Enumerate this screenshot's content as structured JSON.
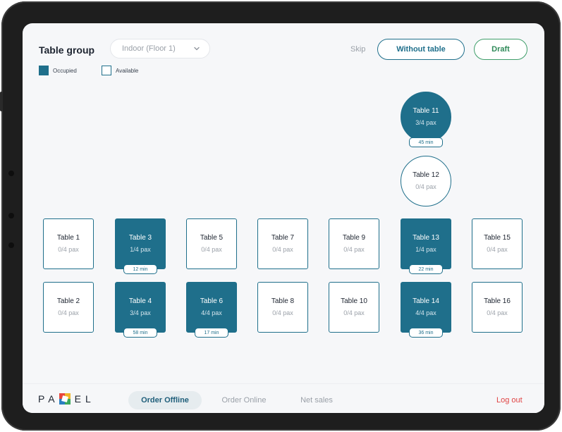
{
  "header": {
    "title": "Table group",
    "dropdown_value": "Indoor (Floor 1)",
    "skip_label": "Skip",
    "without_table_label": "Without table",
    "draft_label": "Draft"
  },
  "legend": {
    "occupied_label": "Occupied",
    "available_label": "Available"
  },
  "colors": {
    "occupied": "#1f6f8b",
    "draft": "#3f9e6a",
    "logout": "#e04343"
  },
  "tables": {
    "t1": {
      "name": "Table 1",
      "pax": "0/4 pax"
    },
    "t2": {
      "name": "Table 2",
      "pax": "0/4 pax"
    },
    "t3": {
      "name": "Table 3",
      "pax": "1/4 pax",
      "timer": "12 min"
    },
    "t4": {
      "name": "Table 4",
      "pax": "3/4 pax",
      "timer": "58 min"
    },
    "t5": {
      "name": "Table 5",
      "pax": "0/4 pax"
    },
    "t6": {
      "name": "Table 6",
      "pax": "4/4 pax",
      "timer": "17 min"
    },
    "t7": {
      "name": "Table 7",
      "pax": "0/4 pax"
    },
    "t8": {
      "name": "Table 8",
      "pax": "0/4 pax"
    },
    "t9": {
      "name": "Table 9",
      "pax": "0/4 pax"
    },
    "t10": {
      "name": "Table 10",
      "pax": "0/4 pax"
    },
    "t11": {
      "name": "Table 11",
      "pax": "3/4 pax",
      "timer": "45 min"
    },
    "t12": {
      "name": "Table 12",
      "pax": "0/4 pax"
    },
    "t13": {
      "name": "Table 13",
      "pax": "1/4 pax",
      "timer": "22 min"
    },
    "t14": {
      "name": "Table 14",
      "pax": "4/4 pax",
      "timer": "36 min"
    },
    "t15": {
      "name": "Table 15",
      "pax": "0/4 pax"
    },
    "t16": {
      "name": "Table 16",
      "pax": "0/4 pax"
    }
  },
  "bottom_nav": {
    "logo_text": "PAEL",
    "items": [
      "Order Offline",
      "Order Online",
      "Net sales"
    ],
    "logout_label": "Log out"
  }
}
